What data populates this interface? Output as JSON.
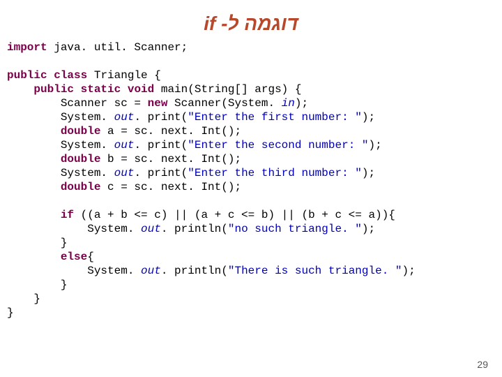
{
  "title": "דוגמה ל- if",
  "pageNumber": "29",
  "code": {
    "kwImport": "import",
    "importRest": " java. util. Scanner;",
    "kwPublic1": "public",
    "kwClass": "class",
    "className": " Triangle {",
    "kwPublic2": "public",
    "kwStatic": "static",
    "kwVoid": "void",
    "mainSig": " main(String[] args) {",
    "scannerA": "        Scanner sc = ",
    "kwNew": "new",
    "scannerB": " Scanner(System. ",
    "inIt": "in",
    "scannerC": ");",
    "sysA": "        System. ",
    "outIt": "out",
    "printA": ". print(",
    "str1": "\"Enter the first number: \"",
    "printEnd": ");",
    "kwDouble": "double",
    "assignA": " a = sc. next. Int();",
    "str2": "\"Enter the second number: \"",
    "assignB": " b = sc. next. Int();",
    "str3": "\"Enter the third number: \"",
    "assignC": " c = sc. next. Int();",
    "kwIf": "if",
    "ifCond": " ((a + b <= c) || (a + c <= b) || (b + c <= a)){",
    "printlnA": ". println(",
    "str4": "\"no such triangle. \"",
    "closeBrace": "        }",
    "kwElse": "else",
    "elseOpen": "{",
    "str5": "\"There is such triangle. \"",
    "closeBrace2": "    }",
    "closeBrace3": "}"
  }
}
